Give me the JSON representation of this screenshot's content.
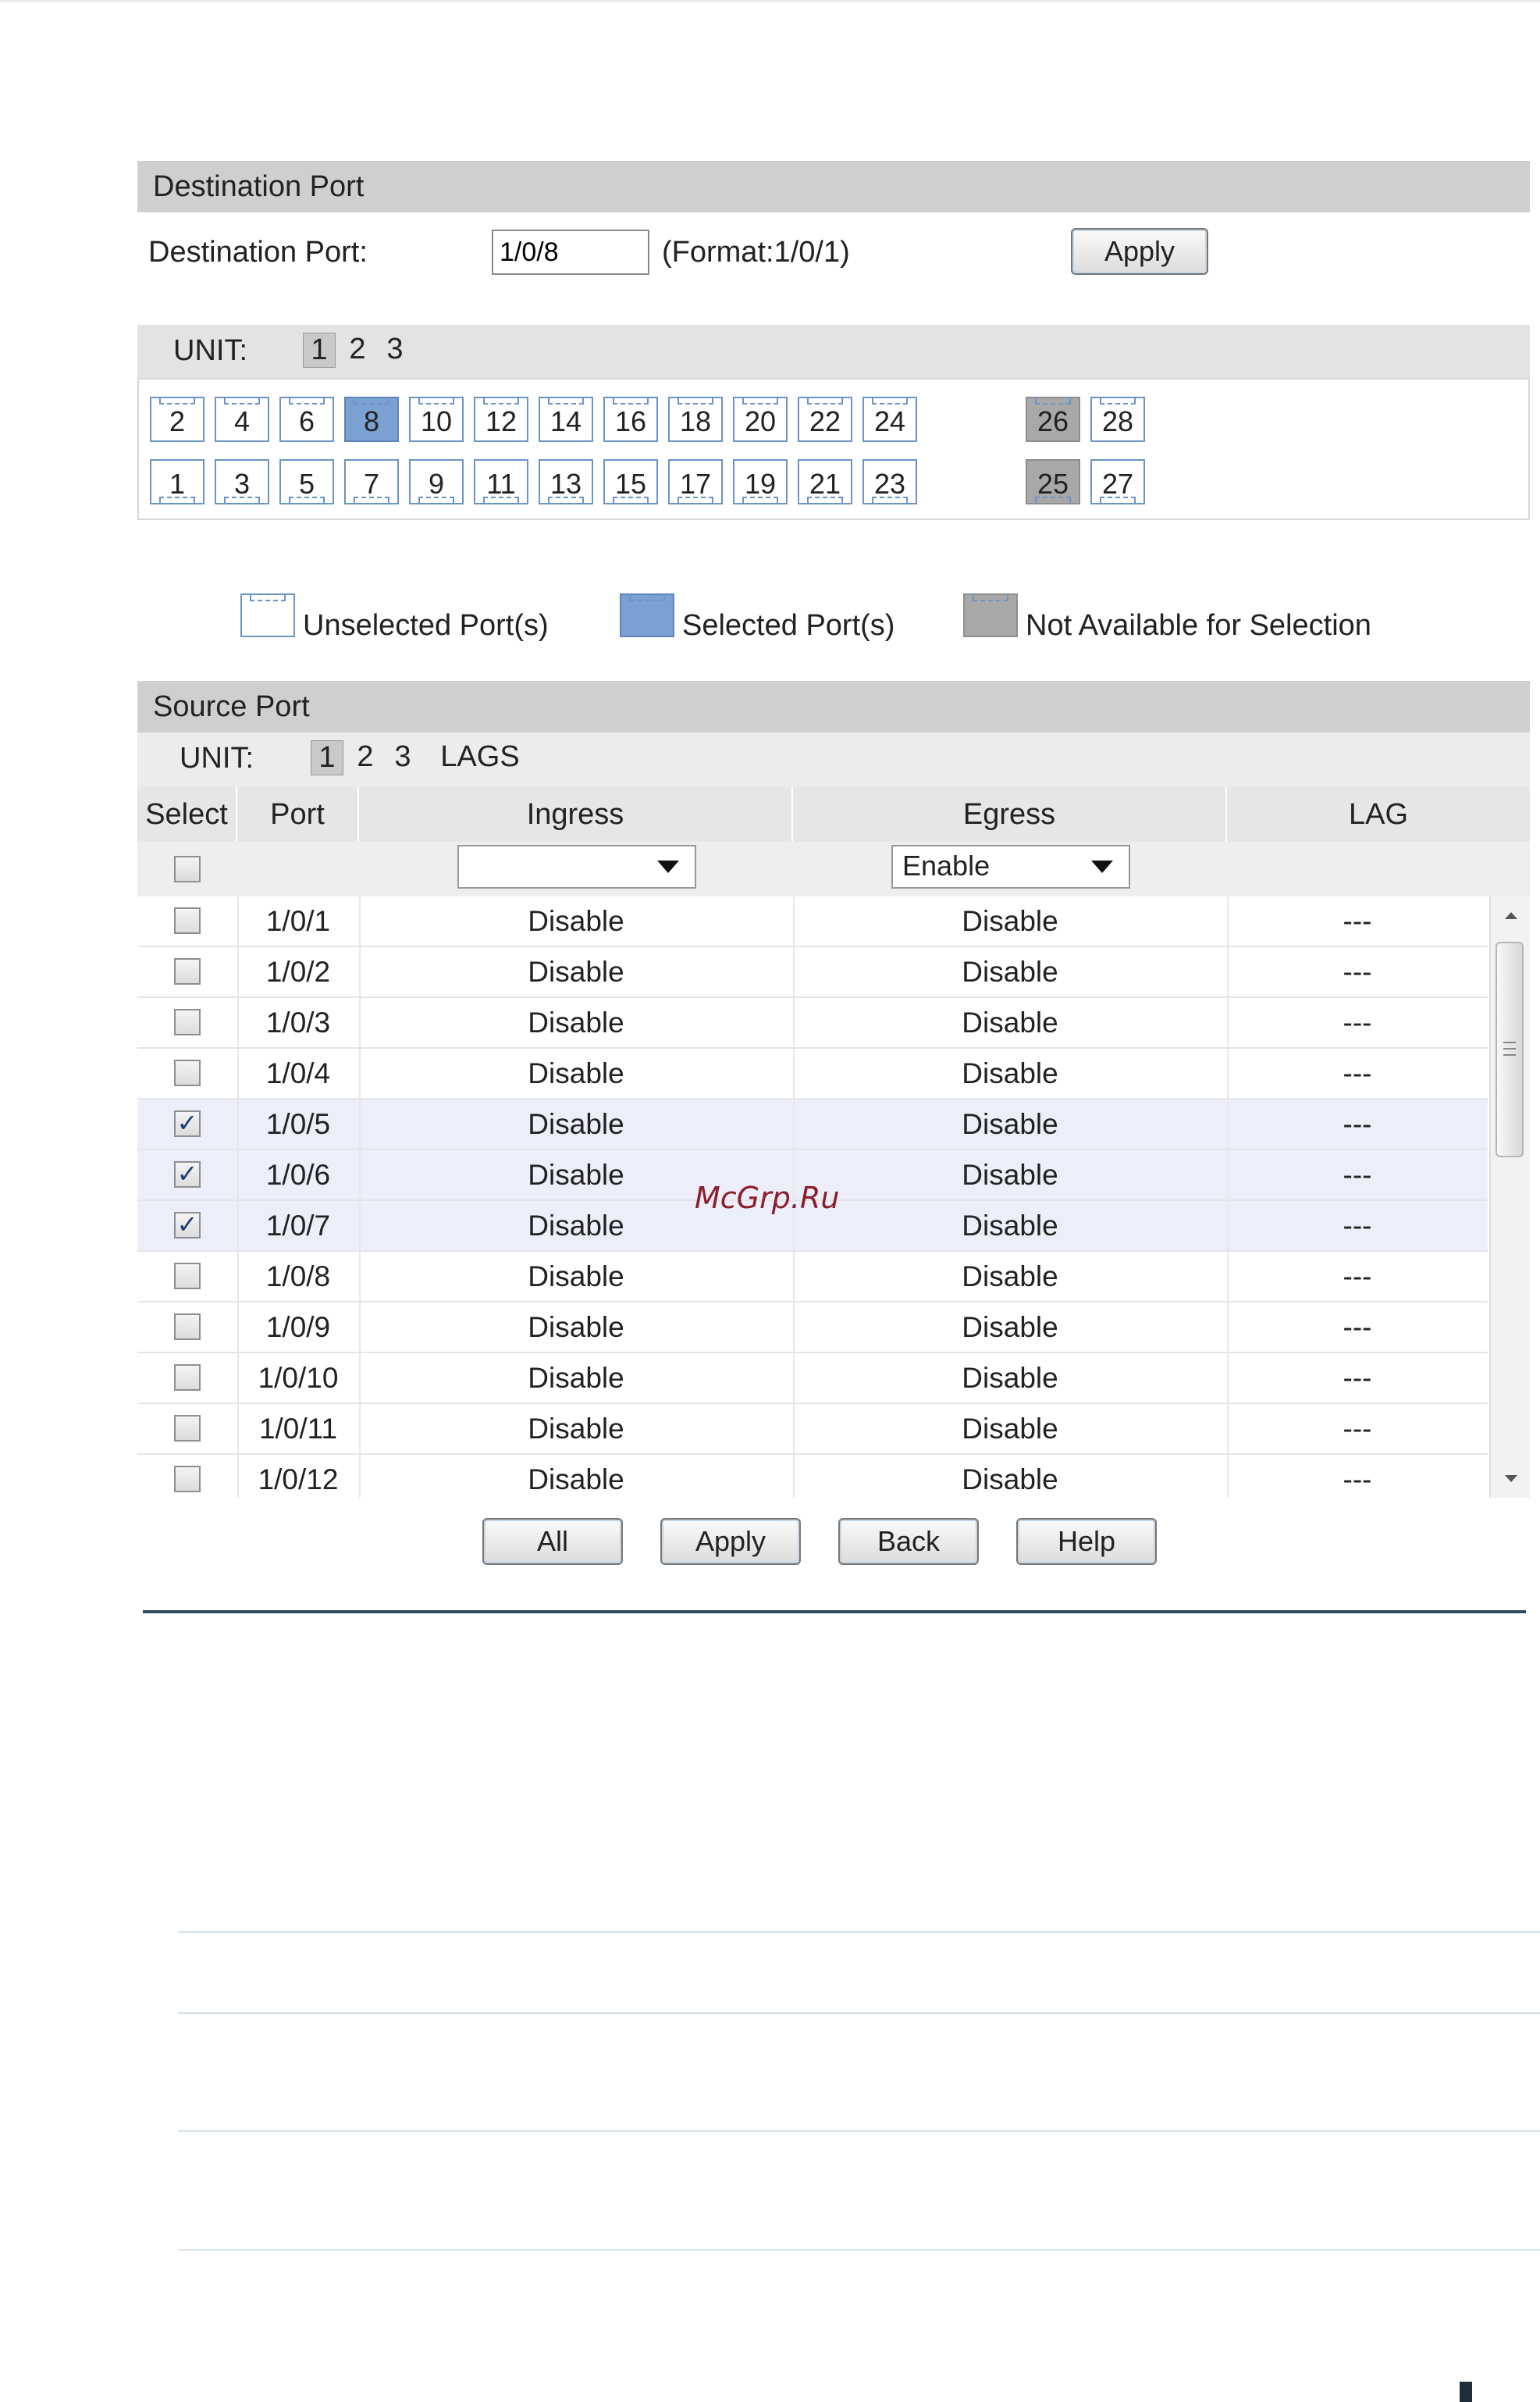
{
  "destination": {
    "header": "Destination Port",
    "label": "Destination Port:",
    "value": "1/0/8",
    "format": "(Format:1/0/1)",
    "apply_label": "Apply",
    "unit_label": "UNIT:",
    "units": [
      "1",
      "2",
      "3"
    ],
    "top_ports": [
      "2",
      "4",
      "6",
      "8",
      "10",
      "12",
      "14",
      "16",
      "18",
      "20",
      "22",
      "24",
      "26",
      "28"
    ],
    "bottom_ports": [
      "1",
      "3",
      "5",
      "7",
      "9",
      "11",
      "13",
      "15",
      "17",
      "19",
      "21",
      "23",
      "25",
      "27"
    ],
    "selected_port": "8",
    "not_available_ports": [
      "25",
      "26"
    ]
  },
  "legend": {
    "unselected": "Unselected Port(s)",
    "selected": "Selected Port(s)",
    "not_available": "Not Available for Selection"
  },
  "source": {
    "header": "Source Port",
    "unit_label": "UNIT:",
    "units": [
      "1",
      "2",
      "3",
      "LAGS"
    ],
    "columns": {
      "select": "Select",
      "port": "Port",
      "ingress": "Ingress",
      "egress": "Egress",
      "lag": "LAG"
    },
    "filter": {
      "ingress": "",
      "egress": "Enable"
    },
    "rows": [
      {
        "port": "1/0/1",
        "ingress": "Disable",
        "egress": "Disable",
        "lag": "---",
        "checked": false
      },
      {
        "port": "1/0/2",
        "ingress": "Disable",
        "egress": "Disable",
        "lag": "---",
        "checked": false
      },
      {
        "port": "1/0/3",
        "ingress": "Disable",
        "egress": "Disable",
        "lag": "---",
        "checked": false
      },
      {
        "port": "1/0/4",
        "ingress": "Disable",
        "egress": "Disable",
        "lag": "---",
        "checked": false
      },
      {
        "port": "1/0/5",
        "ingress": "Disable",
        "egress": "Disable",
        "lag": "---",
        "checked": true
      },
      {
        "port": "1/0/6",
        "ingress": "Disable",
        "egress": "Disable",
        "lag": "---",
        "checked": true
      },
      {
        "port": "1/0/7",
        "ingress": "Disable",
        "egress": "Disable",
        "lag": "---",
        "checked": true
      },
      {
        "port": "1/0/8",
        "ingress": "Disable",
        "egress": "Disable",
        "lag": "---",
        "checked": false
      },
      {
        "port": "1/0/9",
        "ingress": "Disable",
        "egress": "Disable",
        "lag": "---",
        "checked": false
      },
      {
        "port": "1/0/10",
        "ingress": "Disable",
        "egress": "Disable",
        "lag": "---",
        "checked": false
      },
      {
        "port": "1/0/11",
        "ingress": "Disable",
        "egress": "Disable",
        "lag": "---",
        "checked": false
      },
      {
        "port": "1/0/12",
        "ingress": "Disable",
        "egress": "Disable",
        "lag": "---",
        "checked": false
      }
    ]
  },
  "buttons": {
    "all": "All",
    "apply": "Apply",
    "back": "Back",
    "help": "Help"
  },
  "watermark": "McGrp.Ru",
  "colors": {
    "selected_port": "#7aa1d2",
    "not_available_port": "#a8a8a8",
    "header_bg": "#cfcfcf",
    "checked_row": "#eceef9"
  }
}
